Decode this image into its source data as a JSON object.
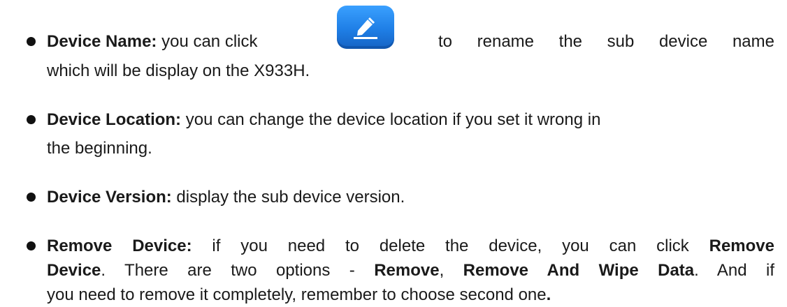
{
  "items": [
    {
      "term": "Device Name:",
      "text_a": " you can click ",
      "text_b": "to rename the sub device name",
      "line2": "which will be display on the X933H.",
      "icon": "edit-pencil-icon",
      "icon_color": "#1f7fe6"
    },
    {
      "term": "Device Location:",
      "text": " you can change the device location if you set it wrong in",
      "line2": "the beginning."
    },
    {
      "term": "Device Version:",
      "text": " display the sub device version."
    },
    {
      "term": "Remove Device:",
      "text_a": " if you need to delete the device, you can click ",
      "bold_a": "Remove",
      "bold_b": "Device",
      "text_b": ". There are two options - ",
      "bold_c": "Remove",
      "sep": ", ",
      "bold_d": "Remove And Wipe Data",
      "text_c": ". And if",
      "line3": "you need to remove it completely, remember to choose second one",
      "end": "."
    }
  ]
}
